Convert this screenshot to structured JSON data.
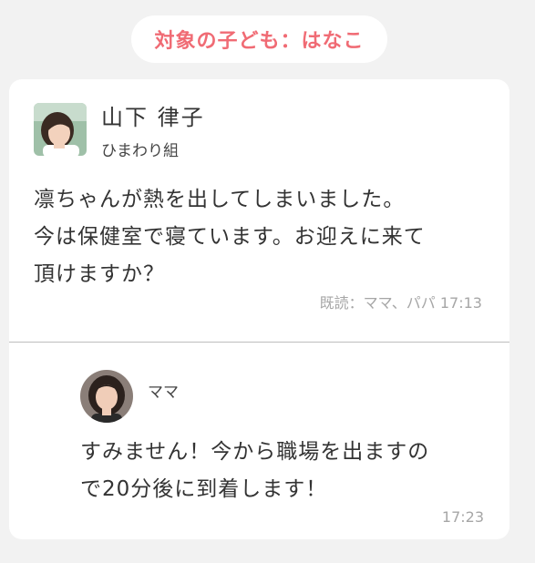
{
  "header": {
    "child_label": "対象の子ども：はなこ"
  },
  "colors": {
    "accent": "#f06b74",
    "background": "#f2f2f2",
    "card": "#ffffff",
    "muted_text": "#a6a6a6"
  },
  "message": {
    "sender_name": "山下 律子",
    "sender_class": "ひまわり組",
    "body": "凛ちゃんが熱を出してしまいました。\n今は保健室で寝ています。お迎えに来て\n頂けますか？",
    "read_status": "既読：ママ、パパ 17:13"
  },
  "reply": {
    "sender_name": "ママ",
    "body": "すみません！今から職場を出ますの\nで20分後に到着します！",
    "time": "17:23"
  }
}
